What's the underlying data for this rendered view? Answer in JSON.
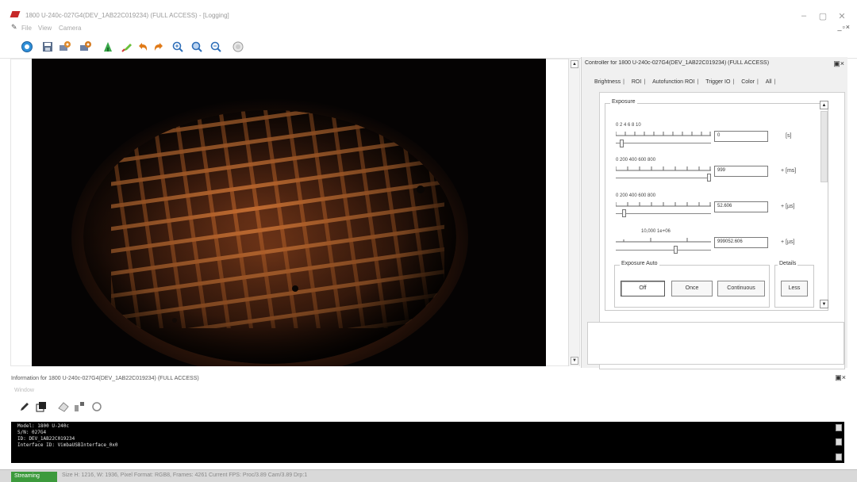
{
  "window": {
    "title": "1800 U-240c-027G4(DEV_1AB22C019234) (FULL ACCESS) - [Logging]",
    "controls": [
      "–",
      "▢",
      "✕"
    ]
  },
  "menubar": {
    "items": [
      "File",
      "View",
      "Camera"
    ],
    "mdi_controls": "_▫×"
  },
  "toolbar": {
    "buttons": [
      "connect-icon",
      "save-icon",
      "settings-camera-icon",
      "settings-camera2-icon",
      "histogram-icon",
      "draw-icon",
      "undo-icon",
      "redo-icon",
      "zoom-in-icon",
      "zoom-fit-icon",
      "zoom-out-icon",
      "reset-icon"
    ]
  },
  "controller": {
    "title": "Controller for 1800 U-240c-027G4(DEV_1AB22C019234) (FULL ACCESS)",
    "tabs": [
      "Brightness",
      "ROI",
      "Autofunction ROI",
      "Trigger IO",
      "Color",
      "All"
    ],
    "exposure_group": "Exposure",
    "sliders": [
      {
        "ticks": "0    2    4    6    8    10",
        "value": "0",
        "unit": "[s]",
        "position": 0.04
      },
      {
        "ticks": "0    200   400   600   800",
        "value": "999",
        "unit": "+ [ms]",
        "position": 0.98
      },
      {
        "ticks": "0    200   400   600   800",
        "value": "52.606",
        "unit": "+ [µs]",
        "position": 0.07
      },
      {
        "ticks": "10,000      1e+06",
        "value": "999052.606",
        "unit": "+ [µs]",
        "position": 0.62
      }
    ],
    "exposure_auto": {
      "label": "Exposure Auto",
      "buttons": [
        "Off",
        "Once",
        "Continuous"
      ],
      "selected": "Off"
    },
    "details": {
      "label": "Details",
      "button": "Less"
    }
  },
  "info": {
    "title": "Information for 1800 U-240c-027G4(DEV_1AB22C019234) (FULL ACCESS)",
    "menu": "Window",
    "toolbar_icons": [
      "pencil-icon",
      "copy-window-icon",
      "eraser-icon",
      "filter-icon",
      "refresh-icon"
    ],
    "console": [
      "Model: 1800 U-240c",
      "S/N: 027G4",
      "ID: DEV_1AB22C019234",
      "Interface ID: VimbaUSBInterface_0x0"
    ]
  },
  "statusbar": {
    "state": "Streaming",
    "details": "Size H: 1216, W: 1936, Pixel Format: RGB8, Frames: 4261 Current FPS: Proc/3.89 Cam/3.89 Drp:1"
  }
}
